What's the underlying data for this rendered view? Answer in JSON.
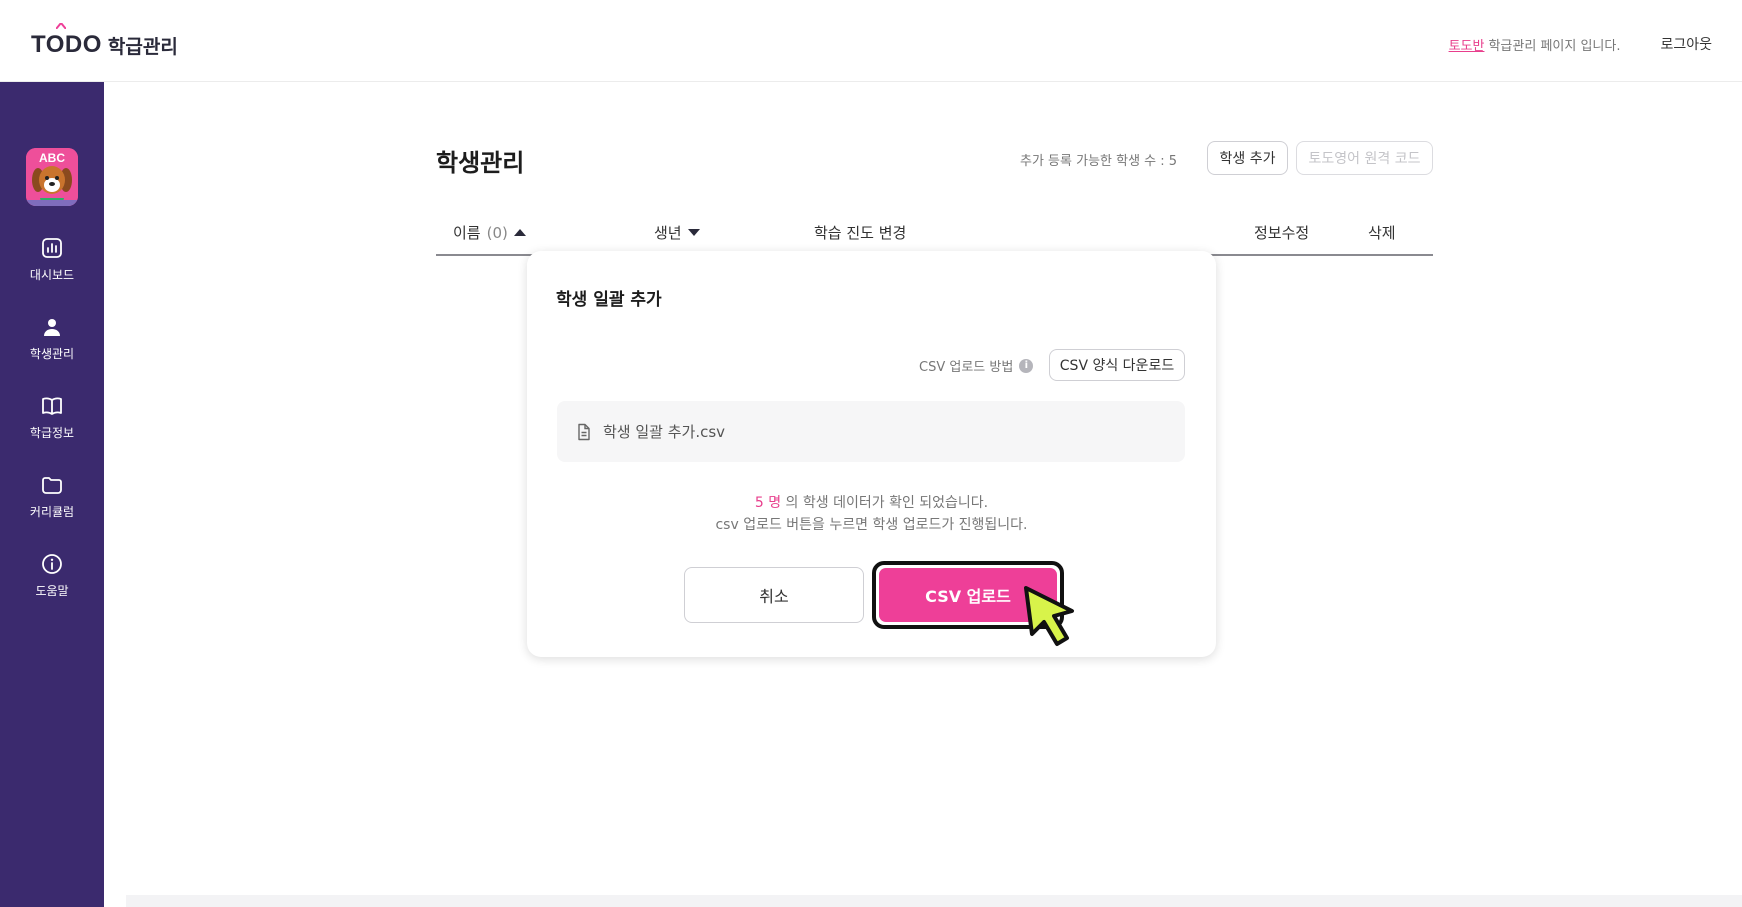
{
  "header": {
    "logo_text": "TODO",
    "logo_sub": "학급관리",
    "class_name": "토도반",
    "notice": "학급관리 페이지 입니다.",
    "logout": "로그아웃"
  },
  "sidebar": {
    "avatar_text": "ABC",
    "items": [
      {
        "label": "대시보드",
        "icon": "chart-icon"
      },
      {
        "label": "학생관리",
        "icon": "person-icon"
      },
      {
        "label": "학급정보",
        "icon": "book-icon"
      },
      {
        "label": "커리큘럼",
        "icon": "folder-icon"
      },
      {
        "label": "도움말",
        "icon": "info-icon"
      }
    ]
  },
  "main": {
    "title": "학생관리",
    "available_text": "추가 등록 가능한 학생 수 : 5",
    "add_button": "학생 추가",
    "code_button": "토도영어 원격 코드",
    "columns": {
      "name": "이름",
      "name_count": "(0)",
      "birth": "생년",
      "progress": "학습 진도 변경",
      "edit": "정보수정",
      "delete": "삭제"
    }
  },
  "modal": {
    "title": "학생 일괄 추가",
    "csv_help": "CSV 업로드 방법",
    "template_button": "CSV 양식 다운로드",
    "file_name": "학생 일괄 추가.csv",
    "count": "5 명",
    "msg_line1_rest": " 의 학생 데이터가 확인 되었습니다.",
    "msg_line2": "csv 업로드 버튼을 누르면 학생 업로드가 진행됩니다.",
    "cancel": "취소",
    "upload": "CSV 업로드"
  },
  "colors": {
    "sidebar": "#3b2a6e",
    "accent": "#ee3f98",
    "cursor": "#d8f34a"
  }
}
